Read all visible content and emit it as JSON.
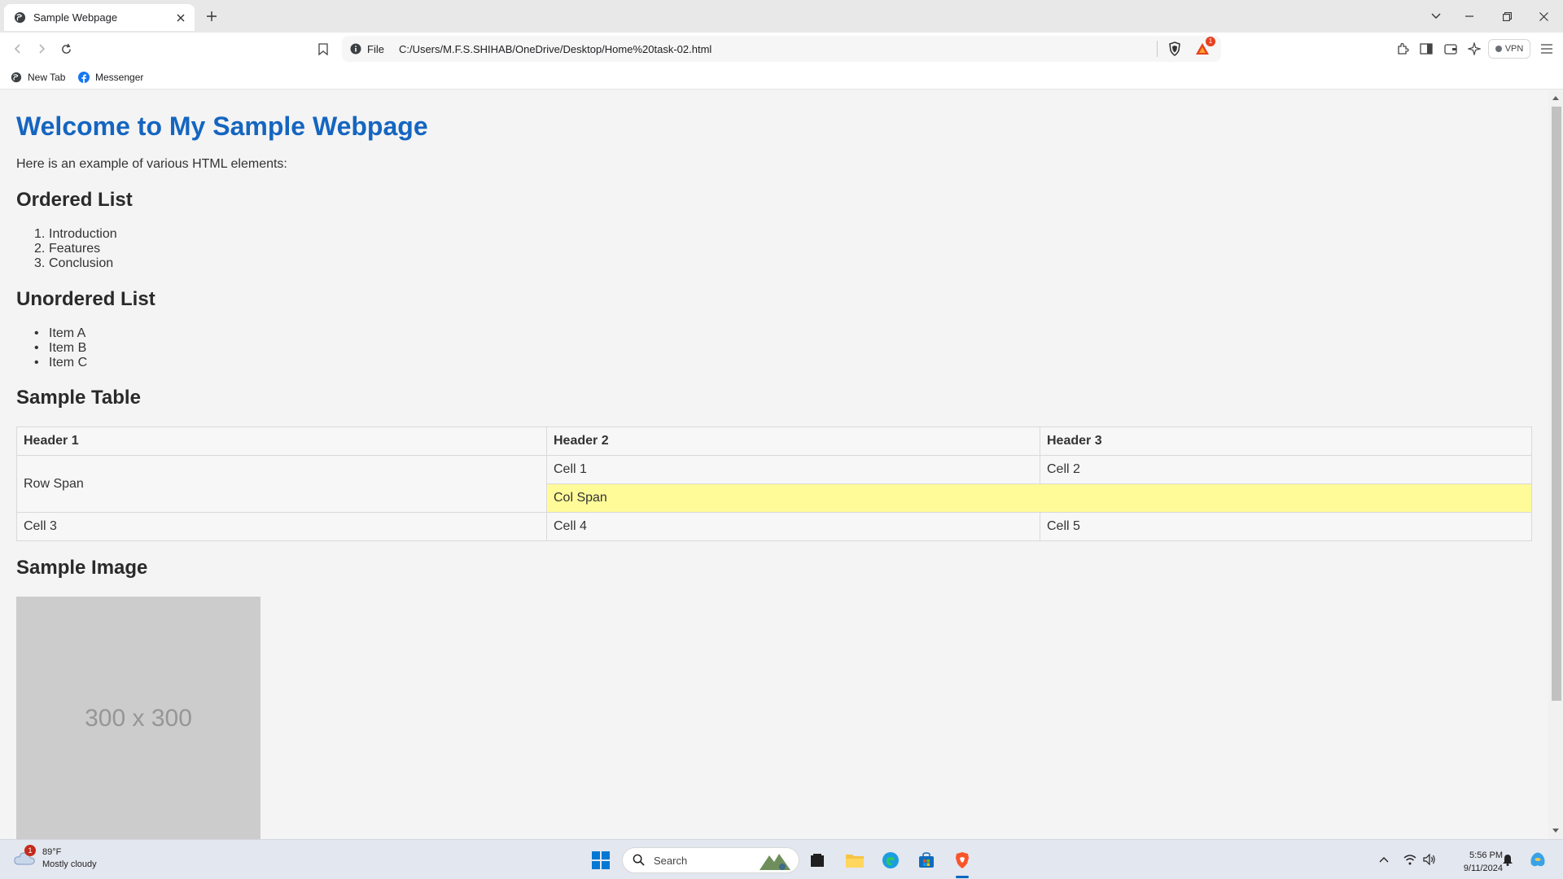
{
  "browser": {
    "tab_title": "Sample Webpage",
    "omnibox_scheme": "File",
    "omnibox_url": "C:/Users/M.F.S.SHIHAB/OneDrive/Desktop/Home%20task-02.html",
    "rewards_badge": "1",
    "vpn_label": "VPN",
    "bookmarks": [
      {
        "label": "New Tab",
        "icon": "globe-icon"
      },
      {
        "label": "Messenger",
        "icon": "facebook-icon"
      }
    ]
  },
  "page": {
    "title": "Welcome to My Sample Webpage",
    "intro": "Here is an example of various HTML elements:",
    "ordered_heading": "Ordered List",
    "ordered_items": [
      "Introduction",
      "Features",
      "Conclusion"
    ],
    "ordered_markers": [
      "1.",
      "2.",
      "3."
    ],
    "unordered_heading": "Unordered List",
    "unordered_items": [
      "Item A",
      "Item B",
      "Item C"
    ],
    "table_heading": "Sample Table",
    "table": {
      "headers": [
        "Header 1",
        "Header 2",
        "Header 3"
      ],
      "row_span": "Row Span",
      "cell1": "Cell 1",
      "cell2": "Cell 2",
      "col_span": "Col Span",
      "cell3": "Cell 3",
      "cell4": "Cell 4",
      "cell5": "Cell 5"
    },
    "image_heading": "Sample Image",
    "image_placeholder": "300 x 300"
  },
  "taskbar": {
    "weather_temp": "89°F",
    "weather_desc": "Mostly cloudy",
    "weather_badge": "1",
    "search_label": "Search",
    "time": "5:56 PM",
    "date": "9/11/2024"
  },
  "colors": {
    "title_blue": "#1565c0",
    "colspan_yellow": "#fffb99",
    "brave_orange": "#fb542b"
  }
}
